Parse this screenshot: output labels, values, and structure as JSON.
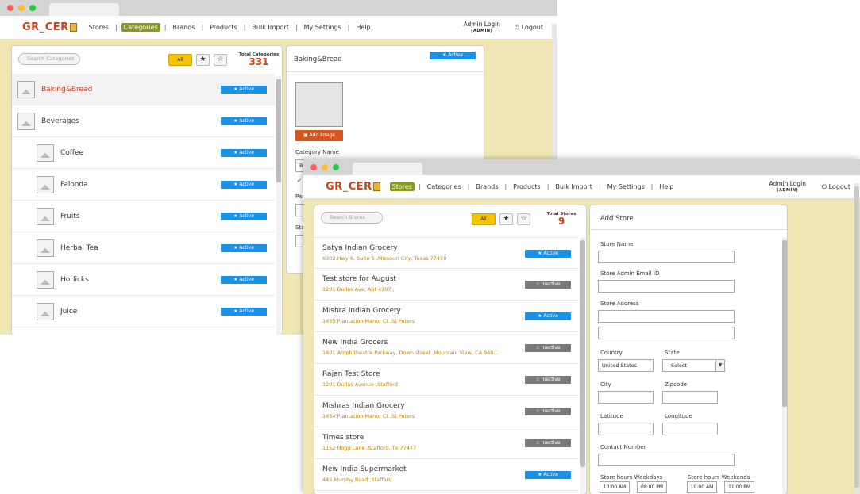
{
  "window1": {
    "nav": {
      "logo": "GR  CER",
      "items": [
        "Stores",
        "Categories",
        "Brands",
        "Products",
        "Bulk Import",
        "My Settings",
        "Help"
      ],
      "active": "Categories",
      "admin_label": "Admin Login",
      "admin_role": "(ADMIN)",
      "logout": "Logout"
    },
    "list": {
      "search_placeholder": "Search Categories",
      "filter_all": "All",
      "total_label": "Total Categories",
      "total_value": "331",
      "rows": [
        {
          "name": "Baking&Bread",
          "status": "★ Active",
          "selected": true
        },
        {
          "name": "Beverages",
          "status": "★ Active"
        },
        {
          "name": "Coffee",
          "status": "★ Active"
        },
        {
          "name": "Falooda",
          "status": "★ Active"
        },
        {
          "name": "Fruits",
          "status": "★ Active"
        },
        {
          "name": "Herbal Tea",
          "status": "★ Active"
        },
        {
          "name": "Horlicks",
          "status": "★ Active"
        },
        {
          "name": "Juice",
          "status": "★ Active"
        }
      ]
    },
    "detail": {
      "title": "Baking&Bread",
      "status": "★ Active",
      "add_image": "Add Image",
      "category_name_label": "Category Name",
      "category_name_value": "Ba",
      "parent_label": "Par",
      "status_label": "Sta"
    }
  },
  "window2": {
    "nav": {
      "logo": "GR  CER",
      "items": [
        "Stores",
        "Categories",
        "Brands",
        "Products",
        "Bulk Import",
        "My Settings",
        "Help"
      ],
      "active": "Stores",
      "admin_label": "Admin Login",
      "admin_role": "(ADMIN)",
      "logout": "Logout"
    },
    "list": {
      "search_placeholder": "Search Stores",
      "filter_all": "All",
      "total_label": "Total Stores",
      "total_value": "9",
      "rows": [
        {
          "name": "Satya Indian Grocery",
          "address": "6302 Hwy 6, Suite S ,Missouri City, Texas 77459",
          "status": "★ Active",
          "active": true
        },
        {
          "name": "Test store for August",
          "address": "1201 Dulles Ave, Apt 4107 ,",
          "status": "☆ Inactive",
          "active": false
        },
        {
          "name": "Mishra Indian Grocery",
          "address": "1455 Plantation Manor Ct ,St Peters",
          "status": "★ Active",
          "active": true
        },
        {
          "name": "New India Grocers",
          "address": "1601 Amphitheatre Parkway, Down street ,Mountain View, CA 940...",
          "status": "☆ Inactive",
          "active": false
        },
        {
          "name": "Rajan Test Store",
          "address": "1201 Dullas Avenue ,Stafford",
          "status": "☆ Inactive",
          "active": false
        },
        {
          "name": "Mishras Indian Grocery",
          "address": "1454 Plantation Manor Ct ,St Peters",
          "status": "☆ Inactive",
          "active": false
        },
        {
          "name": "Times store",
          "address": "1152 Hogg Lane ,Stafford, Tx 77477",
          "status": "☆ Inactive",
          "active": false
        },
        {
          "name": "New India Supermarket",
          "address": "445 Murphy Road ,Stafford",
          "status": "★ Active",
          "active": true
        }
      ]
    },
    "form": {
      "title": "Add Store",
      "store_name": "Store Name",
      "email": "Store Admin Email ID",
      "address": "Store Address",
      "country": "Country",
      "country_value": "United States",
      "state": "State",
      "state_value": "Select",
      "city": "City",
      "zipcode": "Zipcode",
      "latitude": "Latitude",
      "longitude": "Longitude",
      "contact": "Contact Number",
      "hours_weekdays": "Store hours Weekdays",
      "hours_weekends": "Store hours Weekends",
      "wd_open": "10:00 AM",
      "wd_close": "08:00 PM",
      "we_open": "10:00 AM",
      "we_close": "11:00 PM"
    }
  }
}
